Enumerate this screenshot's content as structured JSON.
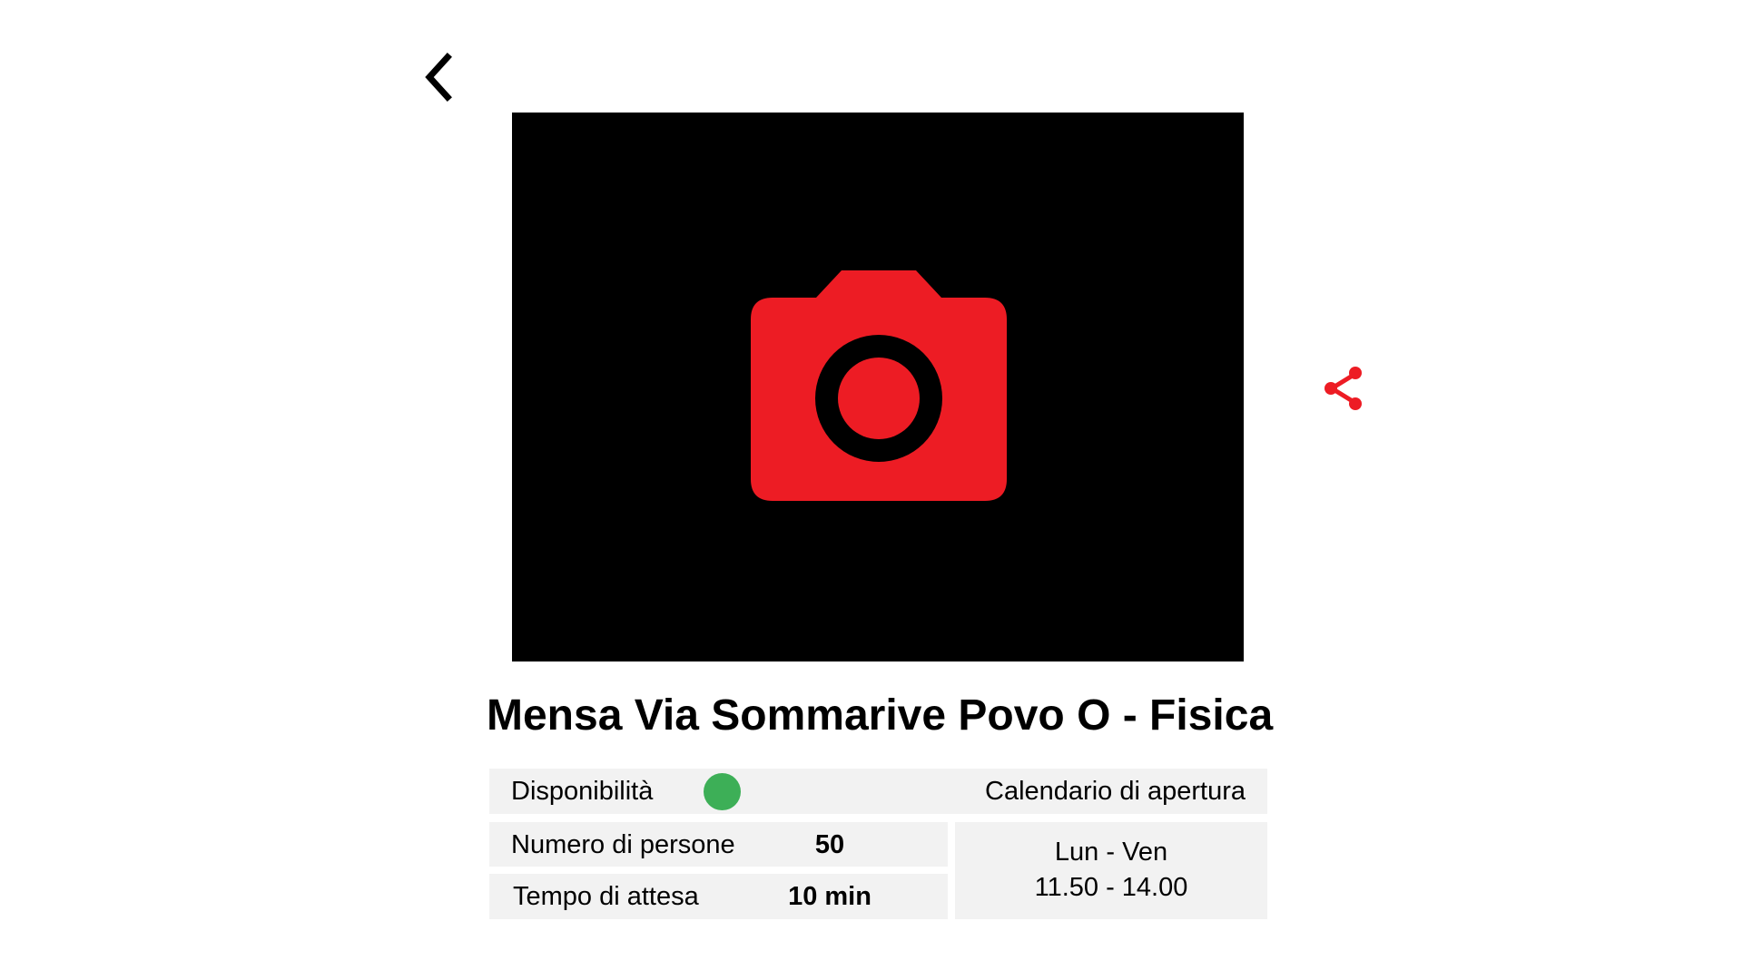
{
  "nav": {
    "back_icon": "chevron-left-icon",
    "share_icon": "share-icon"
  },
  "photo": {
    "placeholder_icon": "camera-icon",
    "background_color": "#000000",
    "icon_color": "#ed1c24"
  },
  "place": {
    "title": "Mensa Via Sommarive Povo O - Fisica"
  },
  "info": {
    "availability_label": "Disponibilità",
    "availability_status_color": "#3daf57",
    "calendar_label": "Calendario di apertura",
    "people_label": "Numero di persone",
    "people_value": "50",
    "wait_label": "Tempo di attesa",
    "wait_value": "10 min",
    "days": "Lun - Ven",
    "hours": "11.50 - 14.00"
  },
  "colors": {
    "accent": "#ed1c24",
    "cell_background": "#f2f2f2"
  }
}
